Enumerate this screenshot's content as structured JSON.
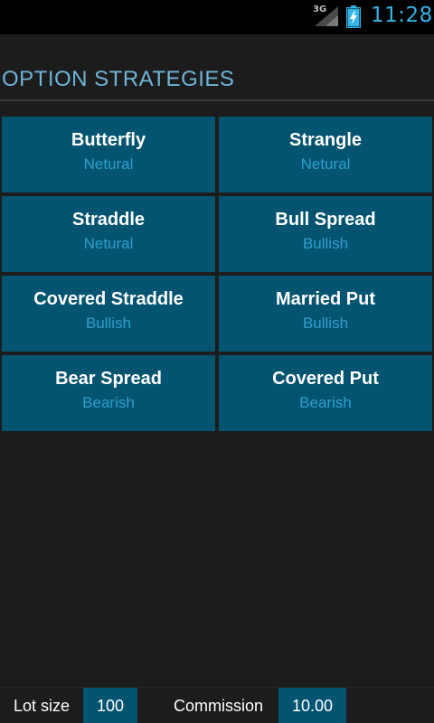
{
  "status_bar": {
    "network_label": "3G",
    "time": "11:28",
    "accent_color": "#33b5e5"
  },
  "page": {
    "title": "OPTION STRATEGIES"
  },
  "strategies": [
    {
      "name": "Butterfly",
      "bias": "Netural"
    },
    {
      "name": "Strangle",
      "bias": "Netural"
    },
    {
      "name": "Straddle",
      "bias": "Netural"
    },
    {
      "name": "Bull Spread",
      "bias": "Bullish"
    },
    {
      "name": "Covered Straddle",
      "bias": "Bullish"
    },
    {
      "name": "Married Put",
      "bias": "Bullish"
    },
    {
      "name": "Bear Spread",
      "bias": "Bearish"
    },
    {
      "name": "Covered Put",
      "bias": "Bearish"
    }
  ],
  "bottom_bar": {
    "lot_size_label": "Lot size",
    "lot_size_value": "100",
    "commission_label": "Commission",
    "commission_value": "10.00"
  },
  "colors": {
    "tile_background": "#035470",
    "bias_text": "#2d9fcc",
    "title_text": "#6eb4d8",
    "background": "#1c1c1c"
  }
}
